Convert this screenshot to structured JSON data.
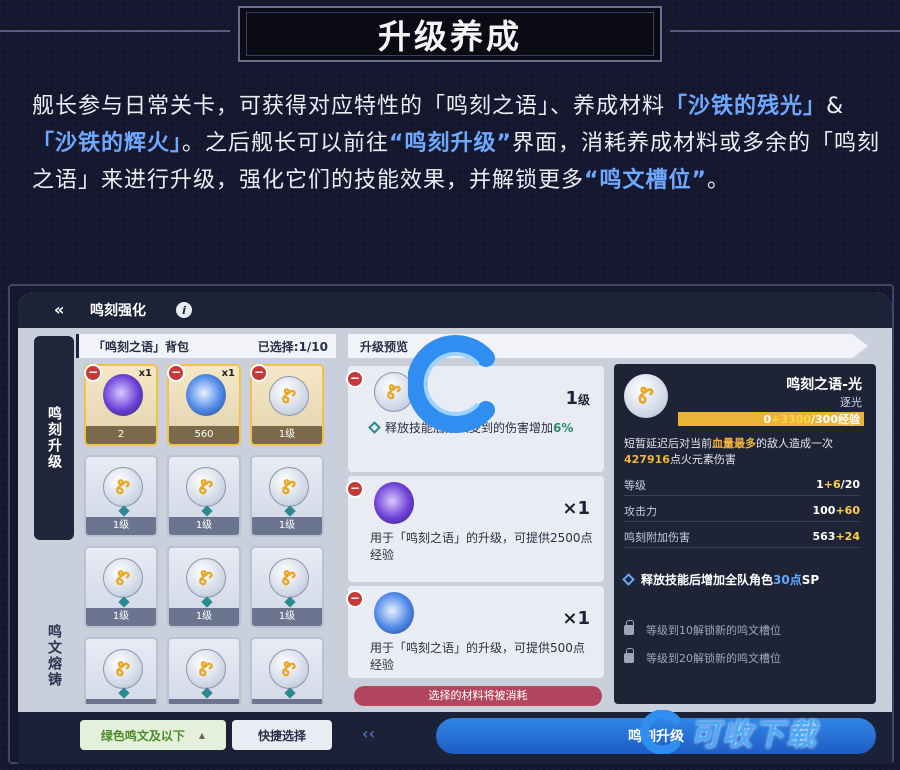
{
  "header": {
    "title": "升级养成"
  },
  "intro": {
    "p1": "舰长参与日常关卡，可获得对应特性的「鸣刻之语」、养成材料",
    "hl1": "「沙铁的",
    "p1b": "",
    "hl1b": "残光」",
    "amp": "&",
    "hl2": "「沙铁的辉火」",
    "p2": "。之后舰长可以前往",
    "hl3": "“鸣刻升级”",
    "p3": "界面，消耗养成材料或多余的「鸣刻之语」来进行升级，强化它们的技能效果，并解锁更多",
    "hl4": "“鸣文槽位”",
    "p4": "。"
  },
  "game": {
    "topbar_title": "鸣刻强化",
    "side_tabs": [
      "鸣刻升级",
      "鸣文熔铸"
    ],
    "inventory": {
      "title": "「鸣刻之语」背包",
      "count": "已选择:1/10",
      "slots": [
        {
          "type": "purple",
          "qty": "x1",
          "label": "2",
          "selected": true
        },
        {
          "type": "blue",
          "qty": "x1",
          "label": "560",
          "selected": true
        },
        {
          "type": "medal",
          "qty": "",
          "label": "1级",
          "selected": true
        },
        {
          "type": "medal",
          "label": "1级"
        },
        {
          "type": "medal",
          "label": "1级"
        },
        {
          "type": "medal",
          "label": "1级"
        },
        {
          "type": "medal",
          "label": "1级"
        },
        {
          "type": "medal",
          "label": "1级"
        },
        {
          "type": "medal",
          "label": "1级"
        },
        {
          "type": "medal",
          "label": ""
        },
        {
          "type": "medal",
          "label": ""
        },
        {
          "type": "medal",
          "label": ""
        }
      ]
    },
    "preview": {
      "title": "升级预览",
      "cards": [
        {
          "big": "1",
          "unit": "级",
          "desc": "释放技能后敌人受到的伤害增加",
          "highlight": "6%"
        },
        {
          "big": "×1",
          "unit": "",
          "desc": "用于「鸣刻之语」的升级，可提供2500点经验",
          "highlight": ""
        },
        {
          "big": "×1",
          "unit": "",
          "desc": "用于「鸣刻之语」的升级，可提供500点经验",
          "highlight": ""
        }
      ],
      "consume_note": "选择的材料将被消耗"
    },
    "detail": {
      "name": "鸣刻之语-光",
      "sub": "逐光",
      "exp_prefix": "0",
      "exp_add": "+3300",
      "exp_max": "/300经验",
      "exp_fraction": 1.0,
      "desc_a": "短暂延迟后对当前",
      "desc_o1": "血量最多",
      "desc_b": "的敌人造成一次",
      "desc_o2": "427916",
      "desc_c": "点火元素伤害",
      "stats": [
        {
          "label": "等级",
          "base": "1",
          "add": "+6",
          "tail": "/20"
        },
        {
          "label": "攻击力",
          "base": "100",
          "add": "+60",
          "tail": ""
        },
        {
          "label": "鸣刻附加伤害",
          "base": "563",
          "add": "+24",
          "tail": ""
        }
      ],
      "skill_a": "释放技能后增加全队角色",
      "skill_b": "30点",
      "skill_c": "SP",
      "locks": [
        "等级到10解锁新的鸣文槽位",
        "等级到20解锁新的鸣文槽位"
      ]
    },
    "bottom": {
      "filter": "绿色鸣文及以下",
      "quick": "快捷选择",
      "upgrade": "鸣刻升级"
    }
  },
  "watermark": {
    "text": "可收下载"
  },
  "colors": {
    "accent": "#6ea9ff",
    "gold": "#f2c14a",
    "panel_dark": "#1d2337"
  }
}
